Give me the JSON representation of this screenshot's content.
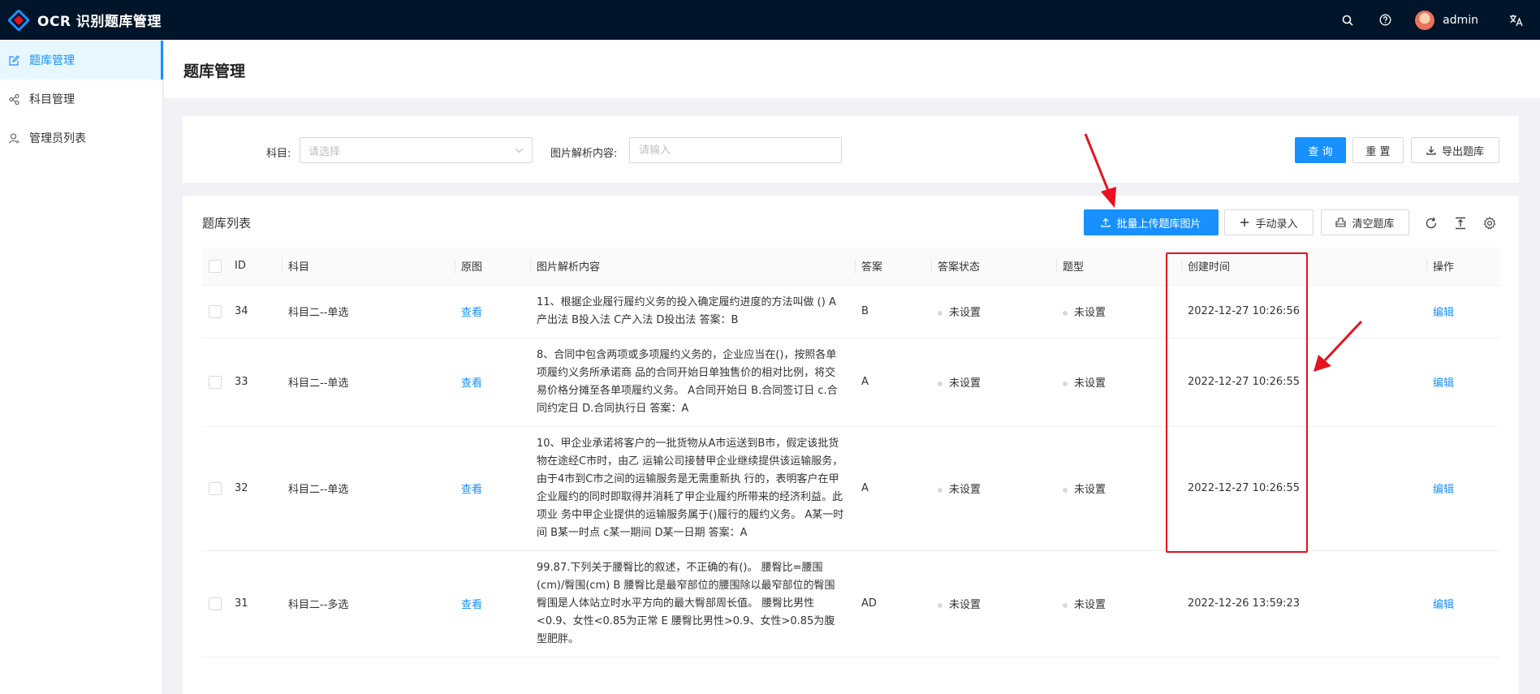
{
  "app": {
    "title": "OCR 识别题库管理",
    "username": "admin"
  },
  "header_icons": [
    "search-icon",
    "help-icon",
    "translate-icon"
  ],
  "sidebar": {
    "items": [
      {
        "label": "题库管理",
        "icon": "edit-icon",
        "active": true
      },
      {
        "label": "科目管理",
        "icon": "share-nodes-icon",
        "active": false
      },
      {
        "label": "管理员列表",
        "icon": "user-icon",
        "active": false
      }
    ]
  },
  "page": {
    "title": "题库管理"
  },
  "search": {
    "subject_label": "科目:",
    "subject_placeholder": "请选择",
    "content_label": "图片解析内容:",
    "content_placeholder": "请输入",
    "query_button": "查 询",
    "reset_button": "重 置",
    "export_button": "导出题库"
  },
  "table_card": {
    "title": "题库列表",
    "upload_button": "批量上传题库图片",
    "manual_button": "手动录入",
    "clear_button": "清空题库"
  },
  "table": {
    "columns": [
      "ID",
      "科目",
      "原图",
      "图片解析内容",
      "答案",
      "答案状态",
      "题型",
      "创建时间",
      "操作"
    ],
    "rows": [
      {
        "id": "34",
        "subject": "科目二--单选",
        "image": "查看",
        "content": "11、根据企业履行履约义务的投入确定履约进度的方法叫做 () A产出法 B投入法 C产入法 D投出法 答案：B",
        "answer": "B",
        "answer_status": "未设置",
        "type": "未设置",
        "created": "2022-12-27 10:26:56",
        "action": "编辑"
      },
      {
        "id": "33",
        "subject": "科目二--单选",
        "image": "查看",
        "content": "8、合同中包含两项或多项履约义务的，企业应当在()，按照各单项履约义务所承诺商 品的合同开始日单独售价的相对比例，将交易价格分摊至各单项履约义务。 A合同开始日 B.合同签订日 c.合同约定日 D.合同执行日 答案：A",
        "answer": "A",
        "answer_status": "未设置",
        "type": "未设置",
        "created": "2022-12-27 10:26:55",
        "action": "编辑"
      },
      {
        "id": "32",
        "subject": "科目二--单选",
        "image": "查看",
        "content": "10、甲企业承诺将客户的一批货物从A市运送到B市，假定该批货物在途经C市时，由乙 运输公司接替甲企业继续提供该运输服务，由于4市到C市之间的运输服务是无需重新执 行的，表明客户在甲企业履约的同时即取得并消耗了甲企业履约所带来的经济利益。此项业 务中甲企业提供的运输服务属于()履行的履约义务。 A某一时间 B某一时点 c某一期间 D某一日期 答案：A",
        "answer": "A",
        "answer_status": "未设置",
        "type": "未设置",
        "created": "2022-12-27 10:26:55",
        "action": "编辑"
      },
      {
        "id": "31",
        "subject": "科目二--多选",
        "image": "查看",
        "content": "99.87.下列关于腰臀比的叙述，不正确的有()。 腰臀比=腰围(cm)/臀围(cm) B 腰臀比是最窄部位的腰围除以最窄部位的臀围 臀围是人体站立时水平方向的最大臀部周长值。 腰臀比男性<0.9、女性<0.85为正常 E 腰臀比男性>0.9、女性>0.85为腹型肥胖。",
        "answer": "AD",
        "answer_status": "未设置",
        "type": "未设置",
        "created": "2022-12-26 13:59:23",
        "action": "编辑"
      }
    ]
  },
  "colors": {
    "primary": "#1890ff",
    "header_bg": "#001529",
    "annotation": "#e5121f"
  }
}
